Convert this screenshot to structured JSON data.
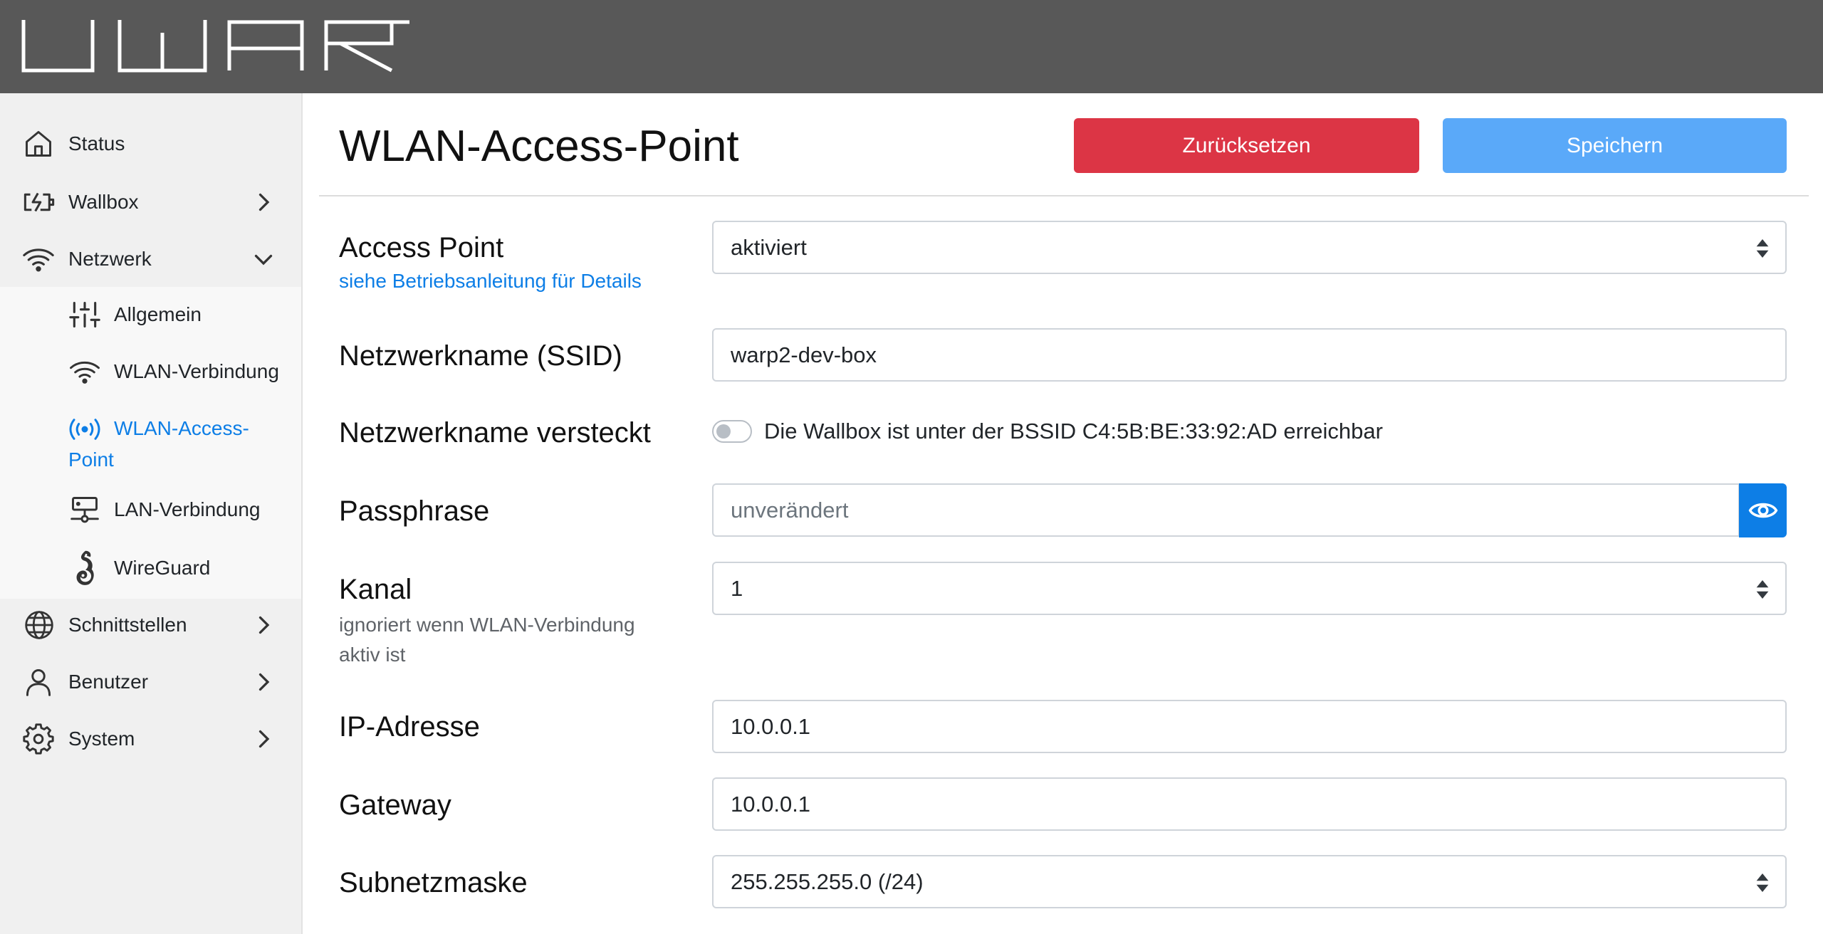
{
  "header": {
    "logo_text": "WARP",
    "color": "#585858"
  },
  "sidebar": {
    "items": [
      {
        "label": "Status",
        "icon": "home-icon"
      },
      {
        "label": "Wallbox",
        "icon": "battery-charging-icon",
        "chevron": "chevron-right-icon"
      },
      {
        "label": "Netzwerk",
        "icon": "wifi-icon",
        "chevron": "chevron-down-icon",
        "expanded": true
      },
      {
        "label": "Schnittstellen",
        "icon": "globe-icon",
        "chevron": "chevron-right-icon"
      },
      {
        "label": "Benutzer",
        "icon": "user-icon",
        "chevron": "chevron-right-icon"
      },
      {
        "label": "System",
        "icon": "gear-icon",
        "chevron": "chevron-right-icon"
      }
    ],
    "netzwerk_subitems": [
      {
        "label": "Allgemein",
        "icon": "sliders-icon"
      },
      {
        "label": "WLAN-Verbindung",
        "icon": "wifi-icon"
      },
      {
        "label_line1": "WLAN-Access-",
        "label_line2": "Point",
        "icon": "radio-broadcast-icon",
        "active": true
      },
      {
        "label": "LAN-Verbindung",
        "icon": "network-server-icon"
      },
      {
        "label": "WireGuard",
        "icon": "wireguard-dragon-icon"
      }
    ],
    "active_color": "#0d7ee6"
  },
  "main": {
    "title": "WLAN-Access-Point",
    "reset_label": "Zurücksetzen",
    "save_label": "Speichern",
    "reset_color": "#dc3545",
    "save_color": "#5aa9f9",
    "fields": {
      "access_point": {
        "label": "Access Point",
        "help_link": "siehe Betriebsanleitung für Details",
        "value": "aktiviert"
      },
      "ssid": {
        "label": "Netzwerkname (SSID)",
        "value": "warp2-dev-box"
      },
      "ssid_hidden": {
        "label": "Netzwerkname versteckt",
        "checked": false,
        "text": "Die Wallbox ist unter der BSSID C4:5B:BE:33:92:AD erreichbar"
      },
      "passphrase": {
        "label": "Passphrase",
        "placeholder": "unverändert",
        "toggle_icon": "eye-icon"
      },
      "channel": {
        "label": "Kanal",
        "help": "ignoriert wenn WLAN-Verbindung aktiv ist",
        "value": "1"
      },
      "ip": {
        "label": "IP-Adresse",
        "value": "10.0.0.1"
      },
      "gateway": {
        "label": "Gateway",
        "value": "10.0.0.1"
      },
      "subnet": {
        "label": "Subnetzmaske",
        "value": "255.255.255.0 (/24)"
      }
    }
  }
}
